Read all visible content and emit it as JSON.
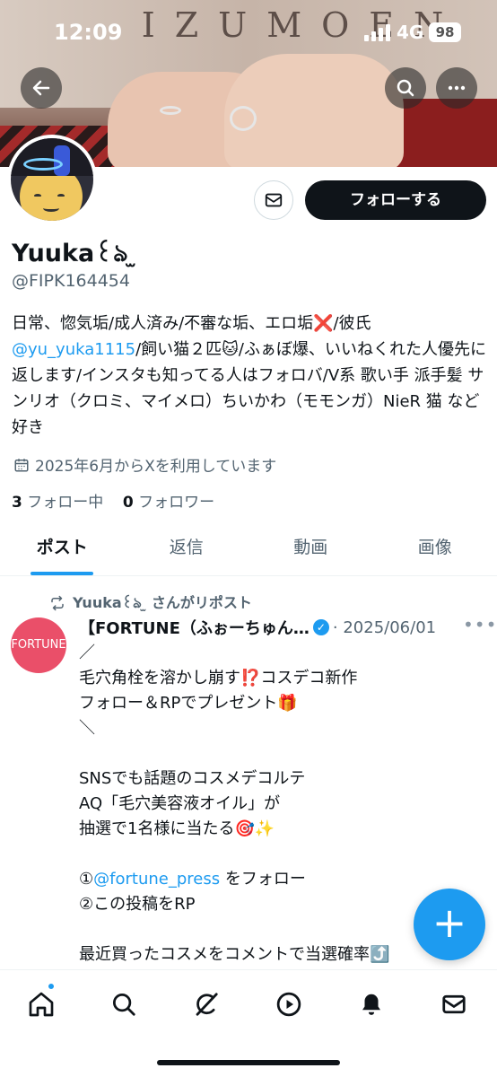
{
  "status_bar": {
    "time": "12:09",
    "network": "4G",
    "battery": "98"
  },
  "banner": {
    "title": "IZUMOEN"
  },
  "profile": {
    "name": "Yuuka꒰ঌ ̫ ",
    "handle": "@FIPK164454",
    "follow_label": "フォローする",
    "bio_part1": "日常、惚気垢/成人済み/不審な垢、エロ垢❌/彼氏",
    "bio_link": "@yu_yuka1115",
    "bio_part2": "/飼い猫２匹🐱/ふぁぼ爆、いいねくれた人優先に返します/インスタも知ってる人はフォロバ/V系 歌い手 派手髪 サンリオ（クロミ、マイメロ）ちいかわ（モモンガ）NieR 猫 など好き",
    "joined": "2025年6月からXを利用しています",
    "following_count": "3",
    "following_label": "フォロー中",
    "followers_count": "0",
    "followers_label": "フォロワー"
  },
  "tabs": [
    {
      "label": "ポスト"
    },
    {
      "label": "返信"
    },
    {
      "label": "動画"
    },
    {
      "label": "画像"
    }
  ],
  "post": {
    "repost_label": "Yuuka꒰ঌ ̫ さんがリポスト",
    "avatar_text": "FORTUNE",
    "author": "【FORTUNE（ふぉーちゅん…",
    "date": "· 2025/06/01",
    "body_part1": "／\n毛穴角栓を溶かし崩す⁉️コスデコ新作\nフォロー＆RPでプレゼント🎁\n＼\n\nSNSでも話題のコスメデコルテ\nAQ「毛穴美容液オイル」が\n抽選で1名様に当たる🎯✨\n\n①",
    "body_link": "@fortune_press",
    "body_part2": " をフォロー\n②この投稿をRP\n\n最近買ったコスメをコメントで当選確率⤴️"
  },
  "icons": {
    "back": "arrow-left-icon",
    "search": "search-icon",
    "more": "more-icon",
    "mail": "mail-icon",
    "calendar": "calendar-icon",
    "repost": "repost-icon",
    "verified": "verified-icon",
    "compose": "plus-icon",
    "nav": [
      "home-icon",
      "search-icon",
      "grok-icon",
      "video-icon",
      "bell-icon",
      "mail-icon"
    ]
  },
  "colors": {
    "accent": "#1d9bf0",
    "text": "#0f1419",
    "muted": "#536471",
    "fortune": "#ea4f69"
  }
}
